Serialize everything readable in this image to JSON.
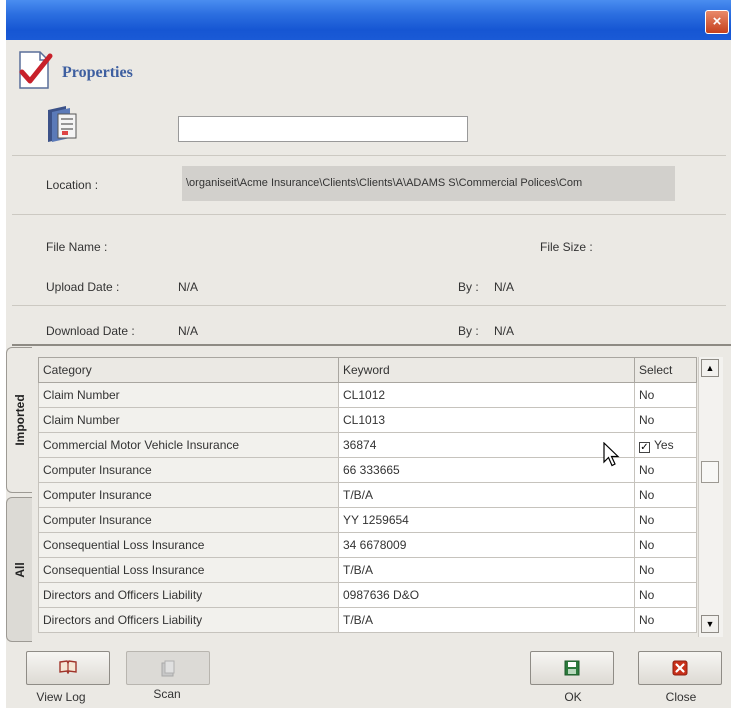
{
  "window": {
    "close_glyph": "×"
  },
  "header": {
    "title": "Properties",
    "name_value": ""
  },
  "location": {
    "label": "Location :",
    "value": "\\organiseit\\Acme Insurance\\Clients\\Clients\\A\\ADAMS S\\Commercial Polices\\Com"
  },
  "file": {
    "name_label": "File Name :",
    "size_label": "File Size :",
    "upload_label": "Upload Date :",
    "upload_value": "N/A",
    "upload_by_label": "By :",
    "upload_by_value": "N/A",
    "download_label": "Download Date :",
    "download_value": "N/A",
    "download_by_label": "By :",
    "download_by_value": "N/A"
  },
  "tabs": {
    "imported": "Imported",
    "all": "All"
  },
  "table": {
    "headers": {
      "category": "Category",
      "keyword": "Keyword",
      "select": "Select"
    },
    "rows": [
      {
        "category": "Claim Number",
        "keyword": "CL1012",
        "select": "No"
      },
      {
        "category": "Claim Number",
        "keyword": "CL1013",
        "select": "No"
      },
      {
        "category": "Commercial Motor Vehicle Insurance",
        "keyword": "36874",
        "select": "Yes"
      },
      {
        "category": "Computer Insurance",
        "keyword": "66 333665",
        "select": "No"
      },
      {
        "category": "Computer Insurance",
        "keyword": "T/B/A",
        "select": "No"
      },
      {
        "category": "Computer Insurance",
        "keyword": "YY 1259654",
        "select": "No"
      },
      {
        "category": "Consequential Loss Insurance",
        "keyword": "34 6678009",
        "select": "No"
      },
      {
        "category": "Consequential Loss Insurance",
        "keyword": "T/B/A",
        "select": "No"
      },
      {
        "category": "Directors and Officers Liability",
        "keyword": "0987636 D&O",
        "select": "No"
      },
      {
        "category": "Directors and Officers Liability",
        "keyword": "T/B/A",
        "select": "No"
      }
    ]
  },
  "buttons": {
    "view_log": "View Log",
    "scan": "Scan",
    "ok": "OK",
    "close": "Close"
  },
  "colors": {
    "titlebar": "#1656d3",
    "accent_title": "#3e5fa0",
    "ok_green": "#2c7a3c",
    "close_red": "#c8301a"
  }
}
